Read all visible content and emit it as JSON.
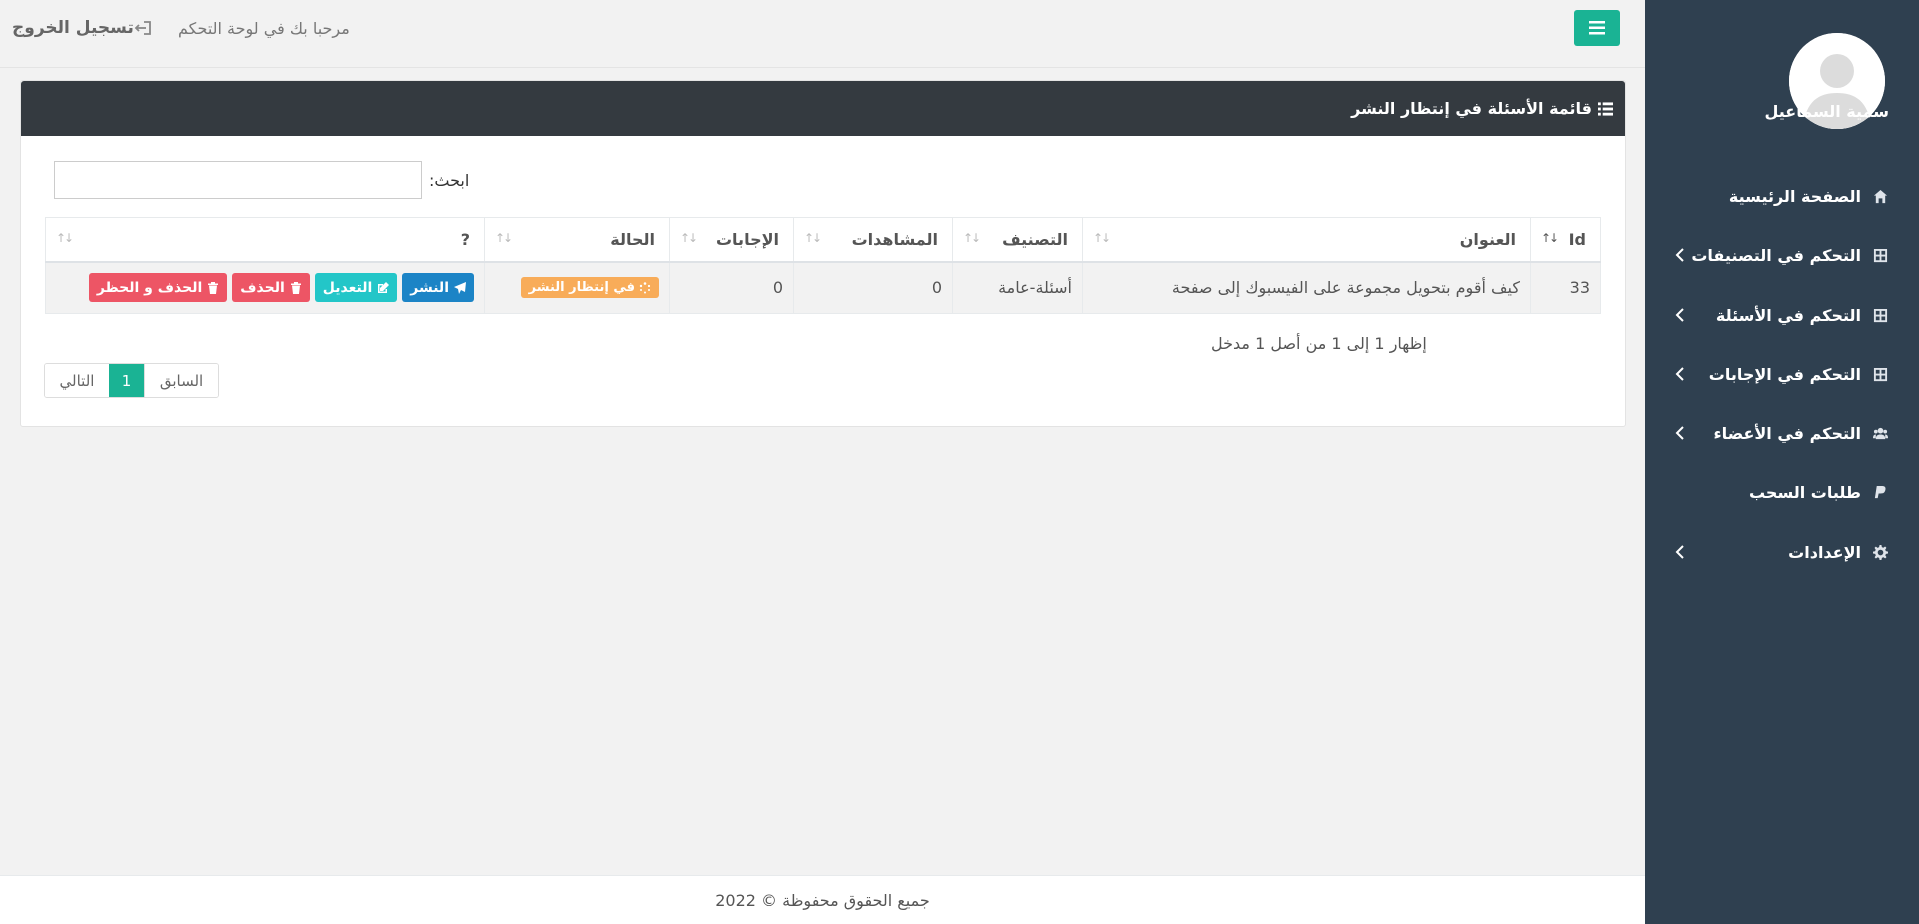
{
  "sidebar": {
    "username": "سمية السماعيل",
    "items": [
      {
        "label": "الصفحة الرئيسية",
        "icon": "home-icon",
        "has_submenu": false
      },
      {
        "label": "التحكم في التصنيفات",
        "icon": "grid-icon",
        "has_submenu": true
      },
      {
        "label": "التحكم في الأسئلة",
        "icon": "grid-icon",
        "has_submenu": true
      },
      {
        "label": "التحكم في الإجابات",
        "icon": "grid-icon",
        "has_submenu": true
      },
      {
        "label": "التحكم في الأعضاء",
        "icon": "users-icon",
        "has_submenu": true
      },
      {
        "label": "طلبات السحب",
        "icon": "paypal-icon",
        "has_submenu": false
      },
      {
        "label": "الإعدادات",
        "icon": "gear-icon",
        "has_submenu": true
      }
    ]
  },
  "topbar": {
    "logout_label": "تسجيل الخروج",
    "welcome_text": "مرحبا بك في لوحة التحكم"
  },
  "panel": {
    "title": "قائمة الأسئلة في إنتظار النشر",
    "search_label": "ابحث:",
    "search_value": "",
    "columns": [
      "Id",
      "العنوان",
      "التصنيف",
      "المشاهدات",
      "الإجابات",
      "الحالة",
      "?"
    ],
    "rows": [
      {
        "id": "33",
        "title": "كيف أقوم بتحويل مجموعة على الفيسبوك إلى صفحة",
        "category": "أسئلة-عامة",
        "views": "0",
        "answers": "0",
        "status": "في إنتظار النشر",
        "actions": {
          "publish": "النشر",
          "edit": "التعديل",
          "delete": "الحذف",
          "delete_ban": "الحذف و الحظر"
        }
      }
    ],
    "info_text": "إظهار 1 إلى 1 من أصل 1 مدخل",
    "pagination": {
      "prev": "السابق",
      "current": "1",
      "next": "التالي"
    }
  },
  "footer": {
    "text": "جميع الحقوق محفوظة © 2022"
  },
  "colors": {
    "sidebar_bg": "#2f4050",
    "accent": "#1ab394",
    "panel_header": "#343a40",
    "badge_warning": "#f8ac59",
    "btn_primary": "#1c84c6",
    "btn_info": "#23c6c8",
    "btn_danger": "#ed5565"
  }
}
